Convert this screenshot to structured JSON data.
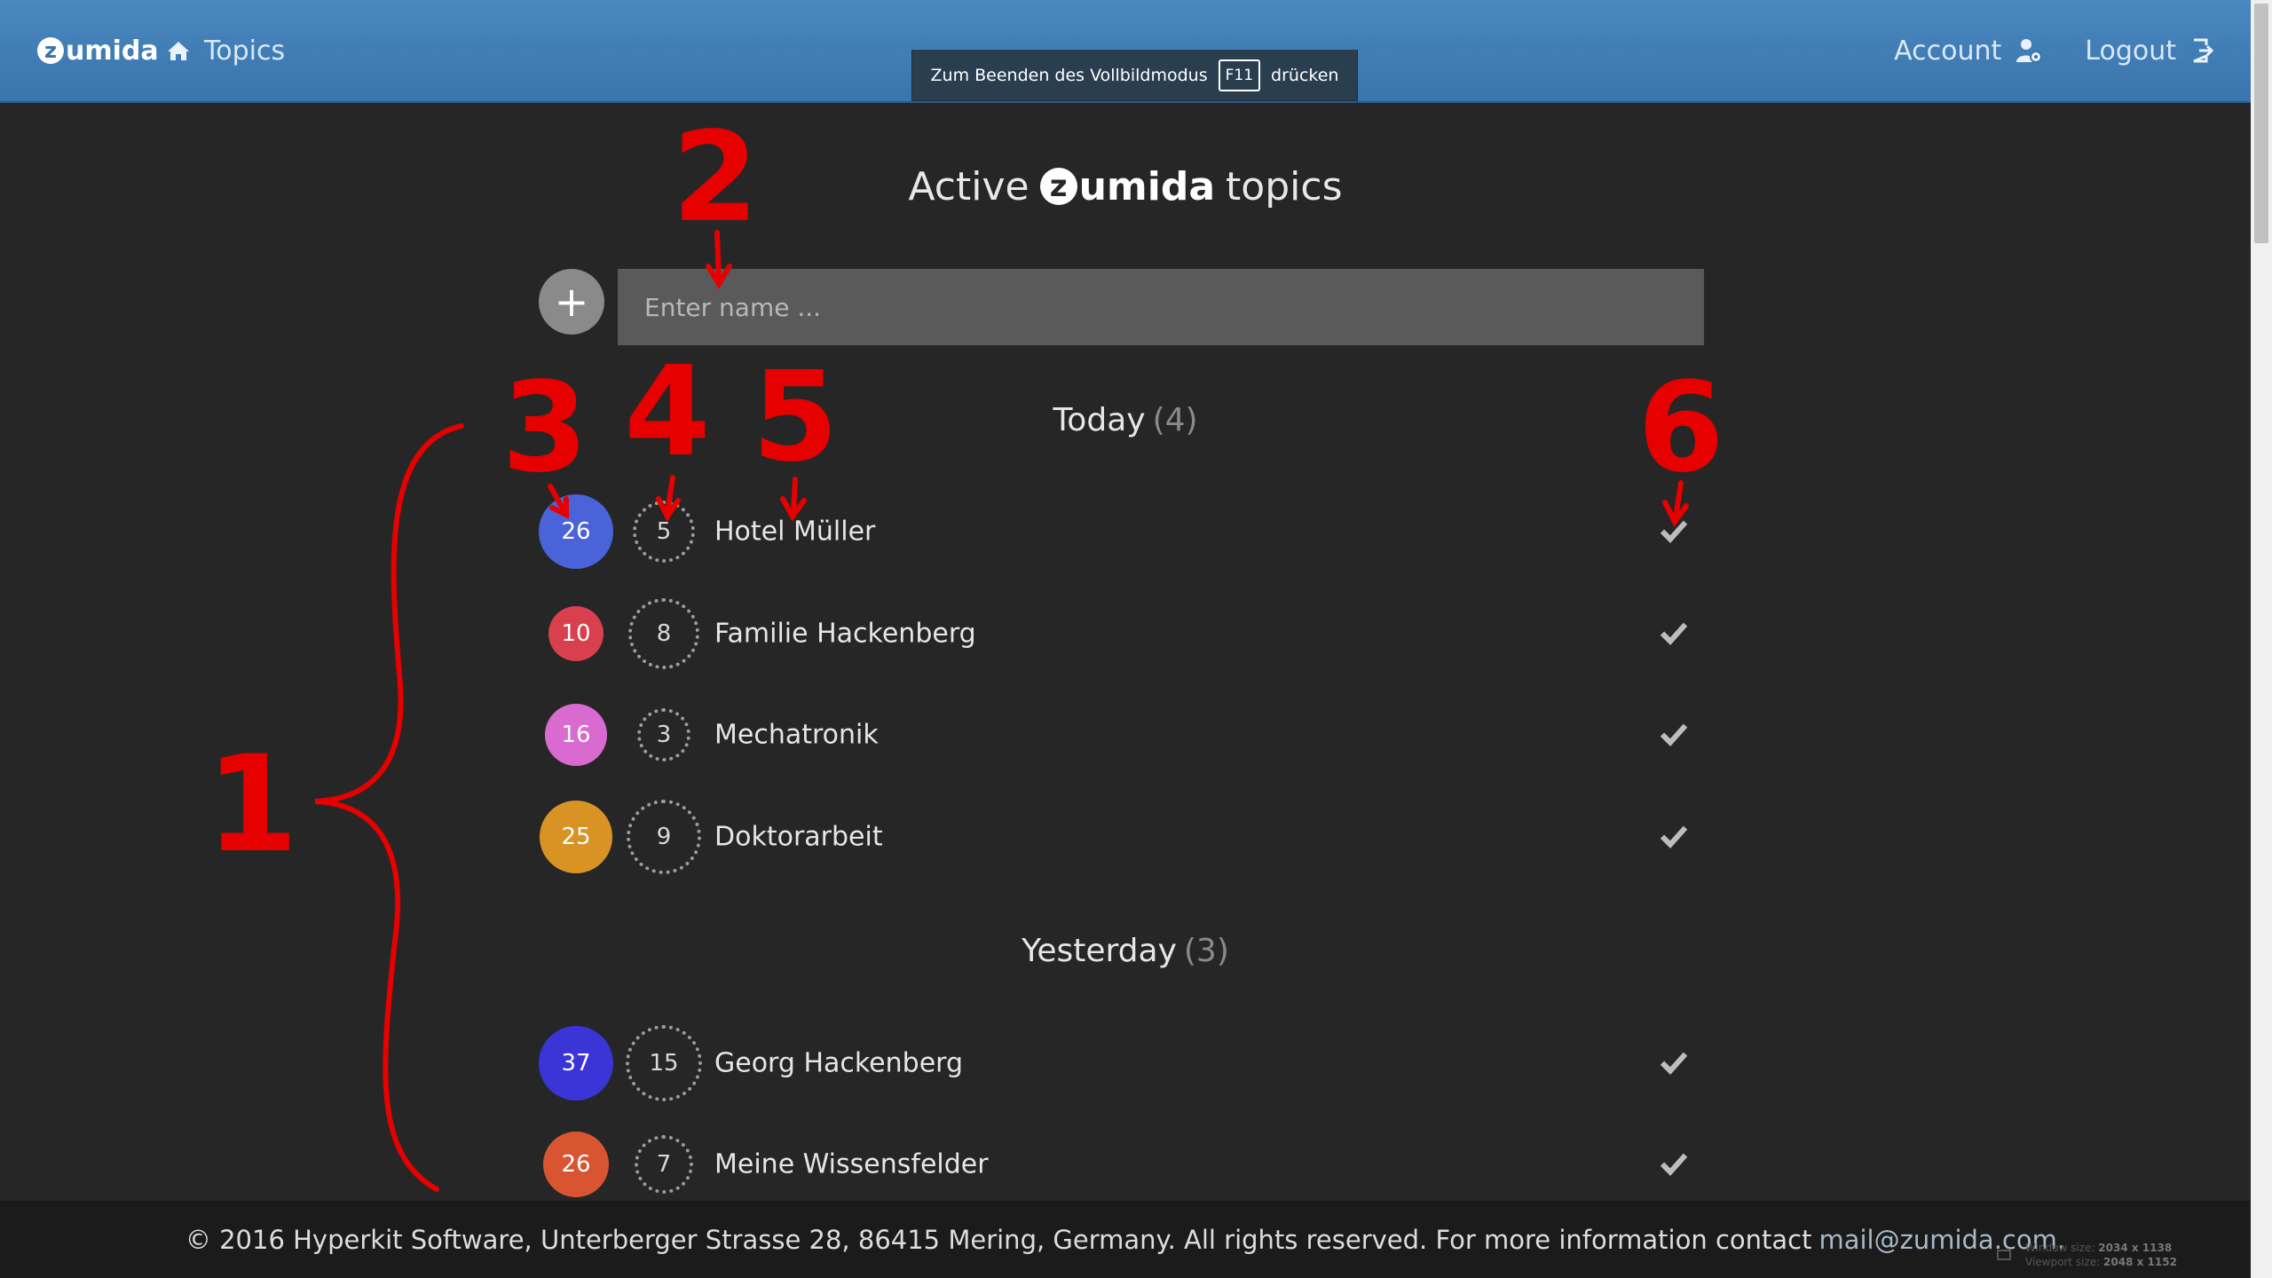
{
  "header": {
    "brand_letter": "z",
    "brand_rest": "umida",
    "nav_topics": "Topics",
    "account": "Account",
    "logout": "Logout"
  },
  "fullscreen_notice": {
    "before": "Zum Beenden des Vollbildmodus",
    "key": "F11",
    "after": "drücken"
  },
  "main": {
    "title_prefix": "Active",
    "title_brand_letter": "z",
    "title_brand_rest": "umida",
    "title_suffix": "topics",
    "add_button": "+",
    "name_placeholder": "Enter name ..."
  },
  "sections": [
    {
      "label": "Today",
      "count": "(4)",
      "topics": [
        {
          "score": "26",
          "color": "#4a63d8",
          "pending": "5",
          "name": "Hotel Müller"
        },
        {
          "score": "10",
          "color": "#d9404e",
          "pending": "8",
          "name": "Familie Hackenberg"
        },
        {
          "score": "16",
          "color": "#d96ad0",
          "pending": "3",
          "name": "Mechatronik"
        },
        {
          "score": "25",
          "color": "#d99324",
          "pending": "9",
          "name": "Doktorarbeit"
        }
      ]
    },
    {
      "label": "Yesterday",
      "count": "(3)",
      "topics": [
        {
          "score": "37",
          "color": "#3b34d6",
          "pending": "15",
          "name": "Georg Hackenberg"
        },
        {
          "score": "26",
          "color": "#d95430",
          "pending": "7",
          "name": "Meine Wissensfelder"
        }
      ]
    }
  ],
  "footer": {
    "text": "© 2016 Hyperkit Software, Unterberger Strasse 28, 86415 Mering, Germany. All rights reserved. For more information contact",
    "email": "mail@zumida.com."
  },
  "window_info": {
    "window_label": "Window size:",
    "window_value": "2034 x 1138",
    "viewport_label": "Viewport size:",
    "viewport_value": "2048 x 1152"
  },
  "annotations": [
    "1",
    "2",
    "3",
    "4",
    "5",
    "6"
  ],
  "colors": {
    "navbar": "#3a74ac",
    "background": "#262626",
    "input": "#5a5a5a",
    "annotation": "#e60000"
  }
}
